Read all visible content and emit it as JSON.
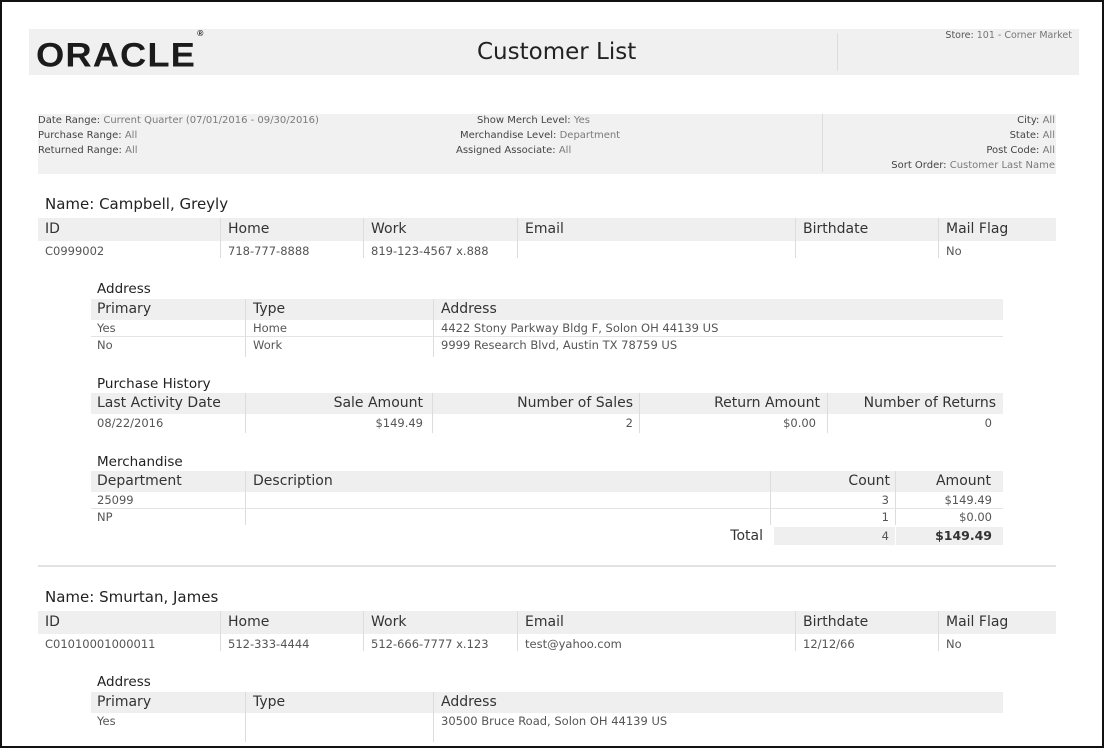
{
  "header": {
    "logo": "ORACLE",
    "logo_mark": "®",
    "title": "Customer List",
    "store_label": "Store:",
    "store_value": "101 - Corner Market"
  },
  "filters": {
    "date_range_label": "Date Range:",
    "date_range_value": "Current Quarter (07/01/2016 - 09/30/2016)",
    "purchase_range_label": "Purchase Range:",
    "purchase_range_value": "All",
    "returned_range_label": "Returned Range:",
    "returned_range_value": "All",
    "show_merch_label": "Show Merch Level:",
    "show_merch_value": "Yes",
    "merch_level_label": "Merchandise Level:",
    "merch_level_value": "Department",
    "assigned_assoc_label": "Assigned Associate:",
    "assigned_assoc_value": "All",
    "city_label": "City:",
    "city_value": "All",
    "state_label": "State:",
    "state_value": "All",
    "post_code_label": "Post Code:",
    "post_code_value": "All",
    "sort_order_label": "Sort Order:",
    "sort_order_value": "Customer Last Name"
  },
  "columns": {
    "customer": [
      "ID",
      "Home",
      "Work",
      "Email",
      "Birthdate",
      "Mail Flag"
    ],
    "address": [
      "Primary",
      "Type",
      "Address"
    ],
    "purchase": [
      "Last Activity Date",
      "Sale Amount",
      "Number of Sales",
      "Return Amount",
      "Number of Returns"
    ],
    "merch": [
      "Department",
      "Description",
      "Count",
      "Amount"
    ]
  },
  "section_titles": {
    "address": "Address",
    "purchase": "Purchase History",
    "merch": "Merchandise",
    "total": "Total"
  },
  "customers": [
    {
      "name": "Name: Campbell, Greyly",
      "row": [
        "C0999002",
        "718-777-8888",
        "819-123-4567 x.888",
        "",
        "",
        "No"
      ],
      "addresses": [
        [
          "Yes",
          "Home",
          "4422 Stony Parkway Bldg F, Solon OH 44139 US"
        ],
        [
          "No",
          "Work",
          "9999 Research Blvd, Austin TX 78759 US"
        ]
      ],
      "purchase": [
        "08/22/2016",
        "$149.49",
        "2",
        "$0.00",
        "0"
      ],
      "merch": [
        [
          "25099",
          "",
          "3",
          "$149.49"
        ],
        [
          "NP",
          "",
          "1",
          "$0.00"
        ]
      ],
      "total_count": "4",
      "total_amount": "$149.49"
    },
    {
      "name": "Name: Smurtan, James",
      "row": [
        "C01010001000011",
        "512-333-4444",
        "512-666-7777 x.123",
        "test@yahoo.com",
        "12/12/66",
        "No"
      ],
      "addresses": [
        [
          "Yes",
          "",
          "30500 Bruce Road, Solon OH 44139 US"
        ]
      ]
    }
  ]
}
